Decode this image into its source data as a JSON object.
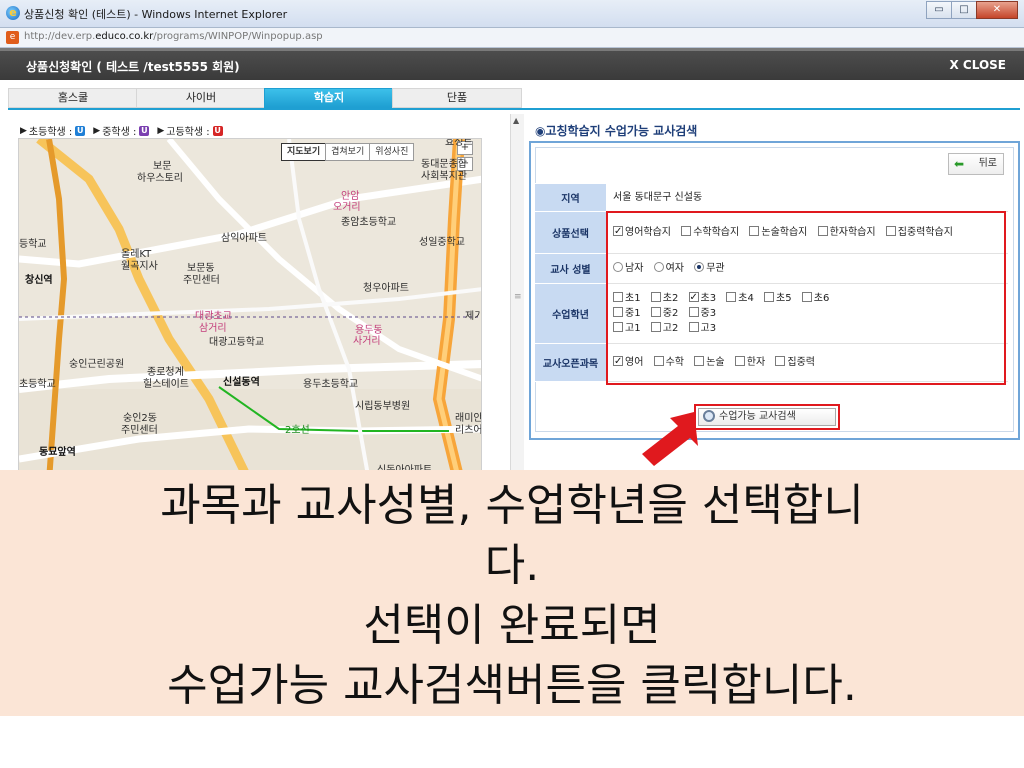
{
  "browser": {
    "title": "상품신청 확인 (테스트) - Windows Internet Explorer",
    "url_prefix": "http://dev.erp.",
    "url_domain": "educo.co.kr",
    "url_path": "/programs/WINPOP/Winpopup.asp",
    "window_buttons": {
      "minimize": "▭",
      "maximize": "□",
      "close": "✕"
    }
  },
  "popup": {
    "title": "상품신청확인 ( 테스트 /test5555 회원)",
    "close_label": "X CLOSE"
  },
  "tabs": [
    {
      "label": "홈스쿨",
      "active": false
    },
    {
      "label": "사이버",
      "active": false
    },
    {
      "label": "학습지",
      "active": true
    },
    {
      "label": "단품",
      "active": false
    }
  ],
  "legend": {
    "elementary": "초등학생 :",
    "middle": "중학생 :",
    "high": "고등학생 :",
    "elementary_icon": "U",
    "middle_icon": "U",
    "high_icon": "U",
    "colors": {
      "elementary": "#1f7fd6",
      "middle": "#7a3fb0",
      "high": "#d62525"
    }
  },
  "map": {
    "type_buttons": [
      "지도보기",
      "겹쳐보기",
      "위성사진"
    ],
    "active_type": "지도보기",
    "zoom_in": "+",
    "zoom_out": "−",
    "labels": {
      "l1": "보문",
      "l2": "하우스토리",
      "l3": "동대문종합",
      "l4": "사회복지관",
      "l5": "안암",
      "l6": "오거리",
      "l7": "종암초등학교",
      "l8": "삼익아파트",
      "l9": "등학교",
      "l10": "올레KT",
      "l11": "월곡지사",
      "l12": "보문동",
      "l13": "주민센터",
      "l14": "성일중학교",
      "l15": "창신역",
      "l16": "청우아파트",
      "l17": "대광초교",
      "l18": "삼거리",
      "l19": "대광고등학교",
      "l20": "용두동",
      "l21": "사거리",
      "l22": "숭인근린공원",
      "l23": "종로청계",
      "l24": "힐스테이트",
      "l25": "신설동역",
      "l26": "용두초등학교",
      "l27": "초등학교",
      "l28": "숭인2동",
      "l29": "주민센터",
      "l30": "시립동부병원",
      "l31": "래미안",
      "l32": "리츠어",
      "l33": "동묘앞역",
      "l34": "신동아아파트",
      "l35": "2호선",
      "l36": "효성트",
      "l37": "제기"
    }
  },
  "search_panel": {
    "title": "◉고칭학습지 수업가능 교사검색",
    "back_label": "뒤로",
    "region_label": "지역",
    "region_value": "서울 동대문구 신설동",
    "product_label": "상품선택",
    "products": [
      {
        "label": "영어학습지",
        "checked": true
      },
      {
        "label": "수학학습지",
        "checked": false
      },
      {
        "label": "논술학습지",
        "checked": false
      },
      {
        "label": "한자학습지",
        "checked": false
      },
      {
        "label": "집중력학습지",
        "checked": false
      }
    ],
    "gender_label": "교사 성별",
    "genders": [
      {
        "label": "남자",
        "checked": false
      },
      {
        "label": "여자",
        "checked": false
      },
      {
        "label": "무관",
        "checked": true
      }
    ],
    "grade_label": "수업학년",
    "grades_elem": [
      {
        "label": "초1",
        "checked": false
      },
      {
        "label": "초2",
        "checked": false
      },
      {
        "label": "초3",
        "checked": true
      },
      {
        "label": "초4",
        "checked": false
      },
      {
        "label": "초5",
        "checked": false
      },
      {
        "label": "초6",
        "checked": false
      }
    ],
    "grades_mid": [
      {
        "label": "중1",
        "checked": false
      },
      {
        "label": "중2",
        "checked": false
      },
      {
        "label": "중3",
        "checked": false
      }
    ],
    "grades_high": [
      {
        "label": "고1",
        "checked": false
      },
      {
        "label": "고2",
        "checked": false
      },
      {
        "label": "고3",
        "checked": false
      }
    ],
    "subject_label": "교사오픈과목",
    "subjects": [
      {
        "label": "영어",
        "checked": true
      },
      {
        "label": "수학",
        "checked": false
      },
      {
        "label": "논술",
        "checked": false
      },
      {
        "label": "한자",
        "checked": false
      },
      {
        "label": "집중력",
        "checked": false
      }
    ],
    "search_button": "수업가능 교사검색"
  },
  "caption": {
    "line1": "과목과 교사성별, 수업학년을 선택합니",
    "line2": "다.",
    "line3": "선택이 완료되면",
    "line4": "수업가능 교사검색버튼을 클릭합니다."
  },
  "colors": {
    "accent_tab": "#1f9fd2",
    "highlight_red": "#e0191e",
    "caption_bg": "#fbe5d6",
    "header_dark": "#3f3f3f"
  }
}
